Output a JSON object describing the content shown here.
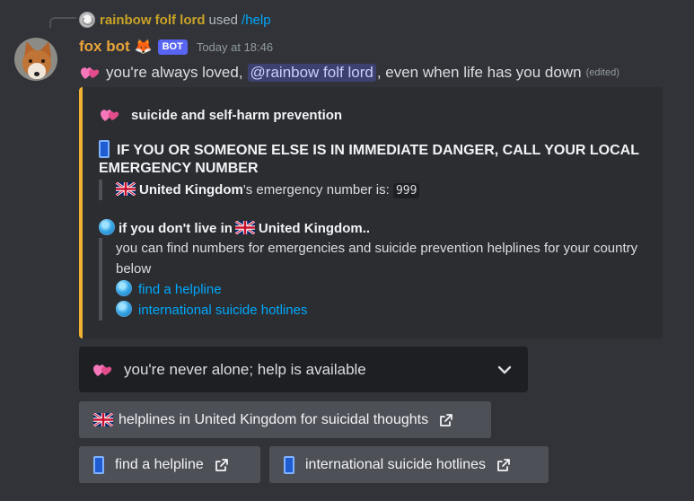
{
  "reply": {
    "username": "rainbow folf lord",
    "used_text": "used",
    "command": "/help"
  },
  "message": {
    "username": "fox bot",
    "username_emoji": "🦊",
    "bot_tag": "BOT",
    "timestamp": "Today at 18:46",
    "text_before": "you're always loved,",
    "mention": "@rainbow folf lord",
    "text_after": ", even when life has you down",
    "edited": "(edited)"
  },
  "embed": {
    "accent_color": "#f0b232",
    "author": "suicide and self-harm prevention",
    "title": "IF YOU OR SOMEONE ELSE IS IN IMMEDIATE DANGER, CALL YOUR LOCAL EMERGENCY NUMBER",
    "country": "United Kingdom",
    "emergency_suffix": "'s emergency number is:",
    "emergency_number": "999",
    "not_live_prefix": "if you don't live in",
    "not_live_country": "United Kingdom..",
    "find_text": "you can find numbers for emergencies and suicide prevention helplines for your country below",
    "link1": "find a helpline",
    "link2": "international suicide hotlines"
  },
  "select": {
    "label": "you're never alone; help is available"
  },
  "buttons": {
    "uk_helplines": "helplines in United Kingdom for suicidal thoughts",
    "find_helpline": "find a helpline",
    "intl_hotlines": "international suicide hotlines"
  },
  "colors": {
    "background": "#313338",
    "username": "#e8a33a",
    "reply_username": "#c9a227",
    "link": "#00a8fc",
    "bot_tag": "#5865f2",
    "button": "#4e5058"
  },
  "icons": [
    "hearts-icon",
    "phone-icon",
    "uk-flag-icon",
    "globe-icon",
    "chevron-down-icon",
    "external-link-icon",
    "fox-icon"
  ]
}
